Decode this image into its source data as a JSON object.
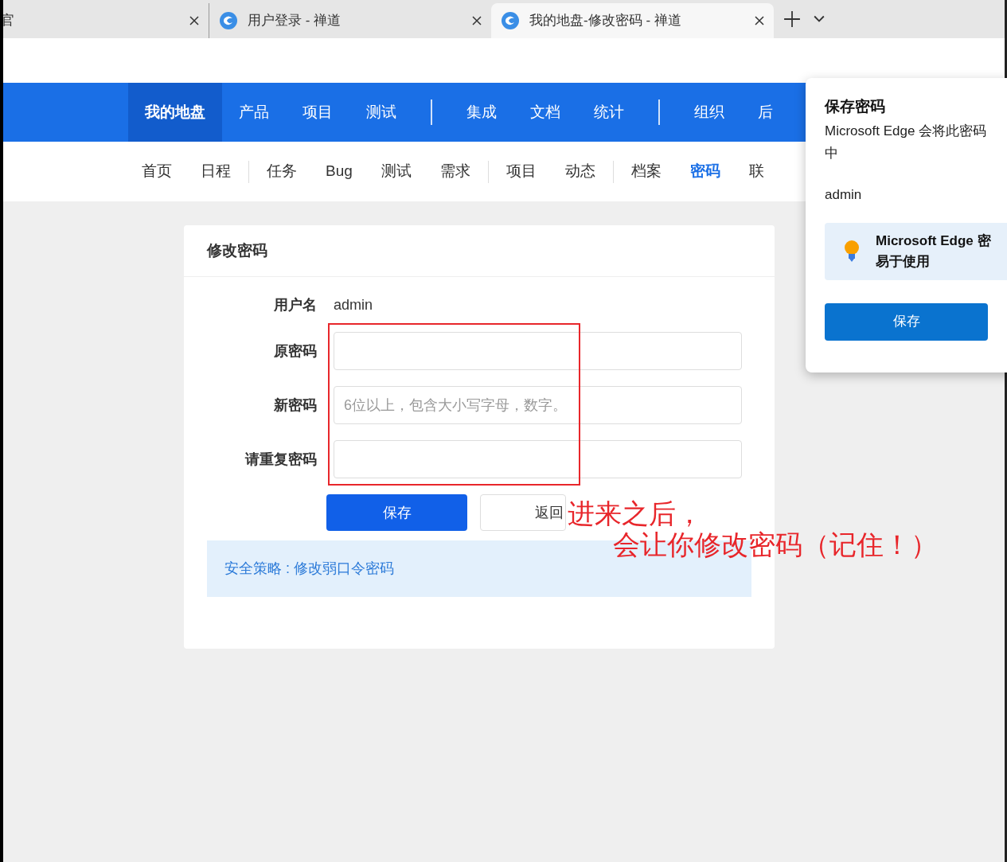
{
  "browser_tabs": [
    {
      "title": "官",
      "selected": false
    },
    {
      "title": "用户登录 - 禅道",
      "selected": false
    },
    {
      "title": "我的地盘-修改密码 - 禅道",
      "selected": true
    }
  ],
  "main_nav": [
    {
      "kind": "item",
      "label": "我的地盘",
      "selected": true
    },
    {
      "kind": "item",
      "label": "产品",
      "selected": false
    },
    {
      "kind": "item",
      "label": "项目",
      "selected": false
    },
    {
      "kind": "item",
      "label": "测试",
      "selected": false
    },
    {
      "kind": "separator"
    },
    {
      "kind": "item",
      "label": "集成",
      "selected": false
    },
    {
      "kind": "item",
      "label": "文档",
      "selected": false
    },
    {
      "kind": "item",
      "label": "统计",
      "selected": false
    },
    {
      "kind": "separator"
    },
    {
      "kind": "item",
      "label": "组织",
      "selected": false
    },
    {
      "kind": "item",
      "label": "后",
      "selected": false
    }
  ],
  "sub_nav": [
    {
      "kind": "item",
      "label": "首页",
      "selected": false
    },
    {
      "kind": "item",
      "label": "日程",
      "selected": false
    },
    {
      "kind": "separator"
    },
    {
      "kind": "item",
      "label": "任务",
      "selected": false
    },
    {
      "kind": "item",
      "label": "Bug",
      "selected": false
    },
    {
      "kind": "item",
      "label": "测试",
      "selected": false
    },
    {
      "kind": "item",
      "label": "需求",
      "selected": false
    },
    {
      "kind": "separator"
    },
    {
      "kind": "item",
      "label": "项目",
      "selected": false
    },
    {
      "kind": "item",
      "label": "动态",
      "selected": false
    },
    {
      "kind": "separator"
    },
    {
      "kind": "item",
      "label": "档案",
      "selected": false
    },
    {
      "kind": "item",
      "label": "密码",
      "selected": true
    },
    {
      "kind": "item",
      "label": "联",
      "selected": false
    }
  ],
  "form": {
    "title": "修改密码",
    "fields": [
      {
        "kind": "static",
        "label": "用户名",
        "value": "admin"
      },
      {
        "kind": "input",
        "label": "原密码"
      },
      {
        "kind": "input",
        "label": "新密码",
        "placeholder": "6位以上，包含大小写字母，数字。"
      },
      {
        "kind": "input",
        "label": "请重复密码"
      }
    ],
    "buttons": [
      {
        "label": "保存",
        "primary": true
      },
      {
        "label": "返回",
        "primary": false
      }
    ],
    "notice": "安全策略 : 修改弱口令密码"
  },
  "annotation": {
    "lines": [
      "进来之后，",
      "会让你修改密码（记住！）"
    ]
  },
  "save_password_popup": {
    "title": "保存密码",
    "message_lines": [
      "Microsoft Edge 会将此密码",
      "中"
    ],
    "username": "admin",
    "tip_lines": [
      "Microsoft Edge 密",
      "易于使用"
    ],
    "button": "保存"
  }
}
